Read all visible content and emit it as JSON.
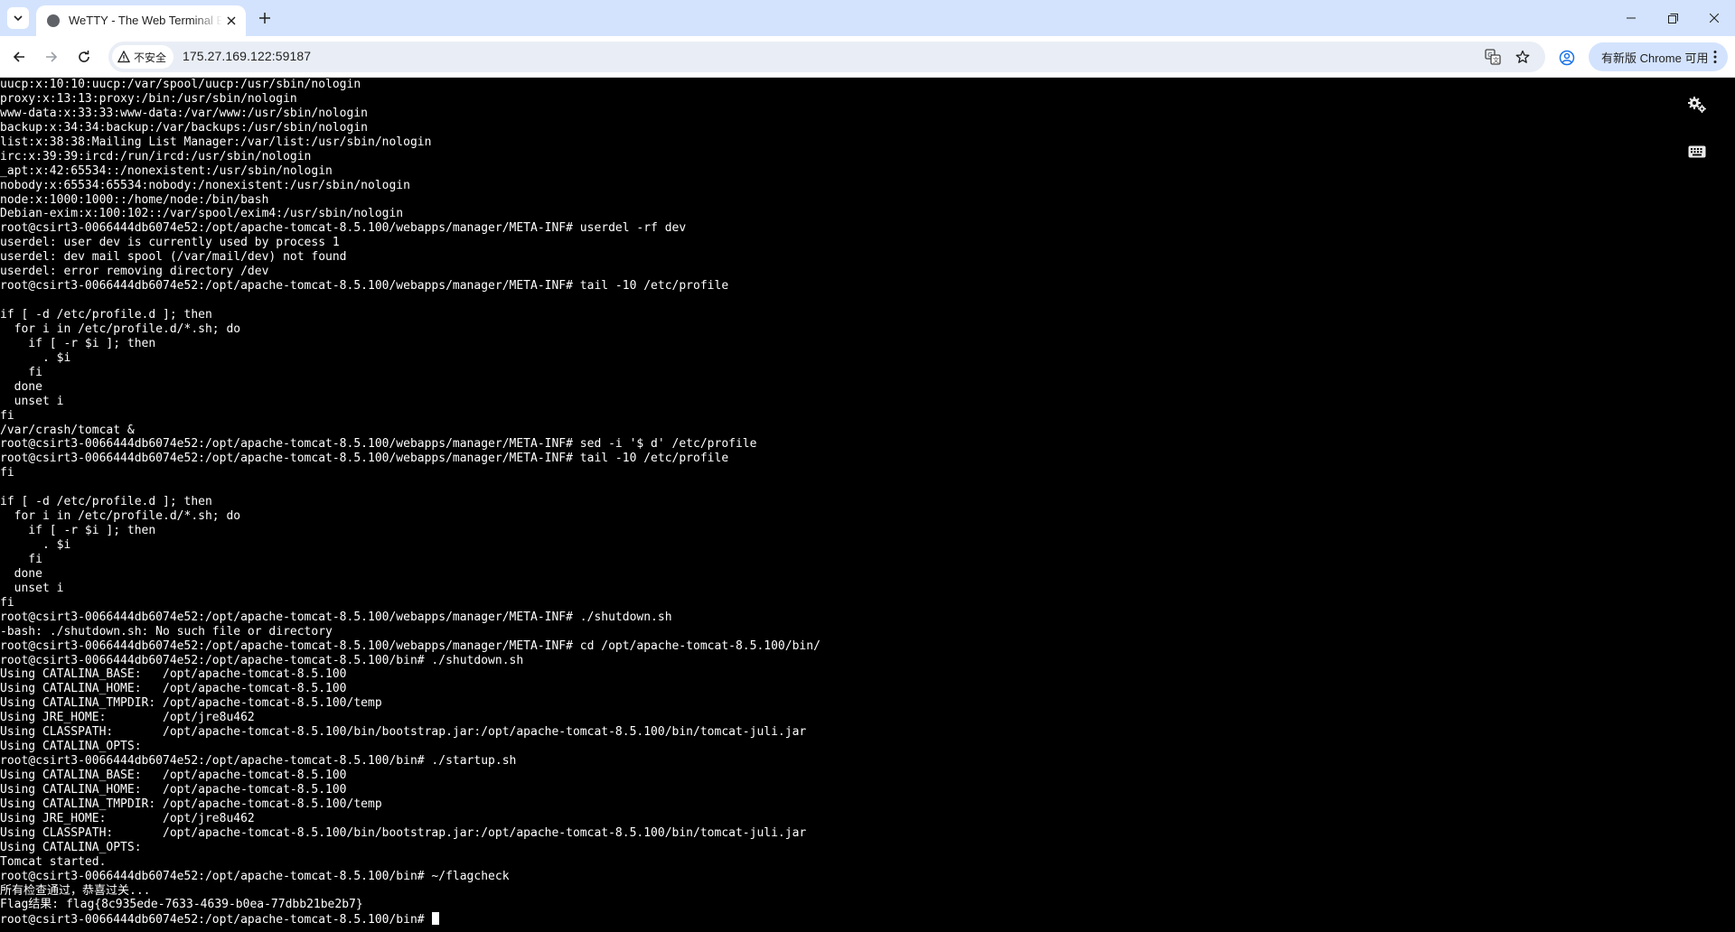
{
  "browser": {
    "tab": {
      "title": "WeTTY - The Web Terminal Emulator",
      "favicon": "globe-icon"
    },
    "new_tab_icon": "plus-icon",
    "window_controls": [
      "minimize-icon",
      "restore-icon",
      "close-icon"
    ],
    "security_label": "不安全",
    "url": "175.27.169.122:59187",
    "update_button_label": "有新版 Chrome 可用",
    "colors": {
      "tabstrip": "#d3e3fd",
      "omnibox": "#e9eef6",
      "update_chip": "#d3e3fd"
    }
  },
  "terminal": {
    "background": "#000000",
    "foreground": "#ffffff",
    "icons": [
      "settings-gears-icon",
      "keyboard-icon"
    ],
    "lines": [
      "uucp:x:10:10:uucp:/var/spool/uucp:/usr/sbin/nologin",
      "proxy:x:13:13:proxy:/bin:/usr/sbin/nologin",
      "www-data:x:33:33:www-data:/var/www:/usr/sbin/nologin",
      "backup:x:34:34:backup:/var/backups:/usr/sbin/nologin",
      "list:x:38:38:Mailing List Manager:/var/list:/usr/sbin/nologin",
      "irc:x:39:39:ircd:/run/ircd:/usr/sbin/nologin",
      "_apt:x:42:65534::/nonexistent:/usr/sbin/nologin",
      "nobody:x:65534:65534:nobody:/nonexistent:/usr/sbin/nologin",
      "node:x:1000:1000::/home/node:/bin/bash",
      "Debian-exim:x:100:102::/var/spool/exim4:/usr/sbin/nologin",
      "root@csirt3-0066444db6074e52:/opt/apache-tomcat-8.5.100/webapps/manager/META-INF# userdel -rf dev",
      "userdel: user dev is currently used by process 1",
      "userdel: dev mail spool (/var/mail/dev) not found",
      "userdel: error removing directory /dev",
      "root@csirt3-0066444db6074e52:/opt/apache-tomcat-8.5.100/webapps/manager/META-INF# tail -10 /etc/profile",
      "",
      "if [ -d /etc/profile.d ]; then",
      "  for i in /etc/profile.d/*.sh; do",
      "    if [ -r $i ]; then",
      "      . $i",
      "    fi",
      "  done",
      "  unset i",
      "fi",
      "/var/crash/tomcat &",
      "root@csirt3-0066444db6074e52:/opt/apache-tomcat-8.5.100/webapps/manager/META-INF# sed -i '$ d' /etc/profile",
      "root@csirt3-0066444db6074e52:/opt/apache-tomcat-8.5.100/webapps/manager/META-INF# tail -10 /etc/profile",
      "fi",
      "",
      "if [ -d /etc/profile.d ]; then",
      "  for i in /etc/profile.d/*.sh; do",
      "    if [ -r $i ]; then",
      "      . $i",
      "    fi",
      "  done",
      "  unset i",
      "fi",
      "root@csirt3-0066444db6074e52:/opt/apache-tomcat-8.5.100/webapps/manager/META-INF# ./shutdown.sh",
      "-bash: ./shutdown.sh: No such file or directory",
      "root@csirt3-0066444db6074e52:/opt/apache-tomcat-8.5.100/webapps/manager/META-INF# cd /opt/apache-tomcat-8.5.100/bin/",
      "root@csirt3-0066444db6074e52:/opt/apache-tomcat-8.5.100/bin# ./shutdown.sh",
      "Using CATALINA_BASE:   /opt/apache-tomcat-8.5.100",
      "Using CATALINA_HOME:   /opt/apache-tomcat-8.5.100",
      "Using CATALINA_TMPDIR: /opt/apache-tomcat-8.5.100/temp",
      "Using JRE_HOME:        /opt/jre8u462",
      "Using CLASSPATH:       /opt/apache-tomcat-8.5.100/bin/bootstrap.jar:/opt/apache-tomcat-8.5.100/bin/tomcat-juli.jar",
      "Using CATALINA_OPTS:",
      "root@csirt3-0066444db6074e52:/opt/apache-tomcat-8.5.100/bin# ./startup.sh",
      "Using CATALINA_BASE:   /opt/apache-tomcat-8.5.100",
      "Using CATALINA_HOME:   /opt/apache-tomcat-8.5.100",
      "Using CATALINA_TMPDIR: /opt/apache-tomcat-8.5.100/temp",
      "Using JRE_HOME:        /opt/jre8u462",
      "Using CLASSPATH:       /opt/apache-tomcat-8.5.100/bin/bootstrap.jar:/opt/apache-tomcat-8.5.100/bin/tomcat-juli.jar",
      "Using CATALINA_OPTS:",
      "Tomcat started.",
      "root@csirt3-0066444db6074e52:/opt/apache-tomcat-8.5.100/bin# ~/flagcheck",
      "所有检查通过，恭喜过关...",
      "Flag结果: flag{8c935ede-7633-4639-b0ea-77dbb21be2b7}",
      "root@csirt3-0066444db6074e52:/opt/apache-tomcat-8.5.100/bin# "
    ]
  }
}
